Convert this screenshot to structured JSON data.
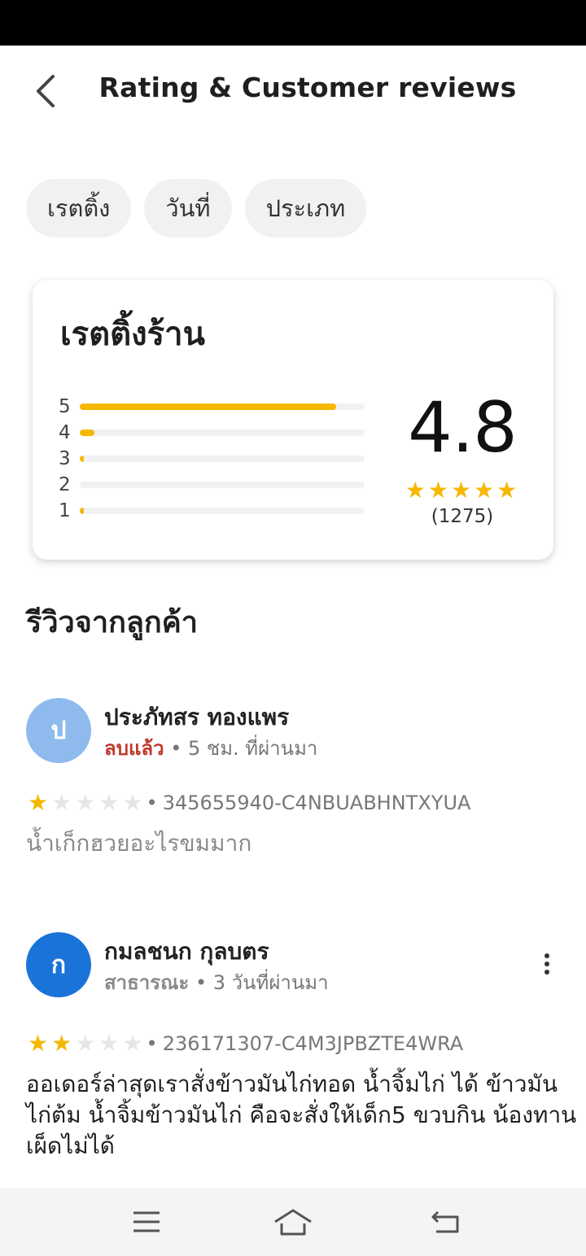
{
  "header": {
    "title": "Rating & Customer reviews"
  },
  "filters": [
    {
      "label": "เรตติ้ง"
    },
    {
      "label": "วันที่"
    },
    {
      "label": "ประเภท"
    }
  ],
  "rating_card": {
    "title": "เรตติ้งร้าน",
    "average": "4.8",
    "average_value": 4.8,
    "count_text": "(1275)",
    "distribution": [
      {
        "label": "5",
        "fraction": 0.9
      },
      {
        "label": "4",
        "fraction": 0.05
      },
      {
        "label": "3",
        "fraction": 0.015
      },
      {
        "label": "2",
        "fraction": 0.0
      },
      {
        "label": "1",
        "fraction": 0.01
      }
    ]
  },
  "reviews_section": {
    "title": "รีวิวจากลูกค้า"
  },
  "reviews": [
    {
      "initial": "ป",
      "avatar_color": "#8ebaee",
      "name": "ประภัทสร ทองแพร",
      "status": "ลบแล้ว",
      "status_color": "#c0392b",
      "time": "5 ชม. ที่ผ่านมา",
      "rating": 1,
      "order_id": "345655940-C4NBUABHNTXYUA",
      "text": "น้ำเก็กฮวยอะไรขมมาก",
      "text_color": "#8a8a8a",
      "has_menu": false
    },
    {
      "initial": "ก",
      "avatar_color": "#1a73d9",
      "name": "กมลชนก กุลบตร",
      "status": "สาธารณะ",
      "status_color": "#8a8a8a",
      "time": "3 วันที่ผ่านมา",
      "rating": 2,
      "order_id": "236171307-C4M3JPBZTE4WRA",
      "text": "ออเดอร์ล่าสุดเราสั่งข้าวมันไก่ทอด น้ำจิ้มไก่ ได้ ข้าวมันไก่ต้ม น้ำจิ้มข้าวมันไก่ คือจะสั่งให้เด็ก5 ขวบกิน น้องทานเผ็ดไม่ได้",
      "text_color": "#1f1f1f",
      "has_menu": true
    }
  ],
  "separator": "•",
  "star_glyph": "★",
  "colors": {
    "accent": "#f5b800",
    "chip_bg": "#f1f1f1",
    "track": "#f1f1f1"
  },
  "icons": {
    "back": "chevron-left-icon",
    "more": "more-vertical-icon",
    "nav_menu": "menu-icon",
    "nav_home": "home-icon",
    "nav_back": "return-icon"
  }
}
